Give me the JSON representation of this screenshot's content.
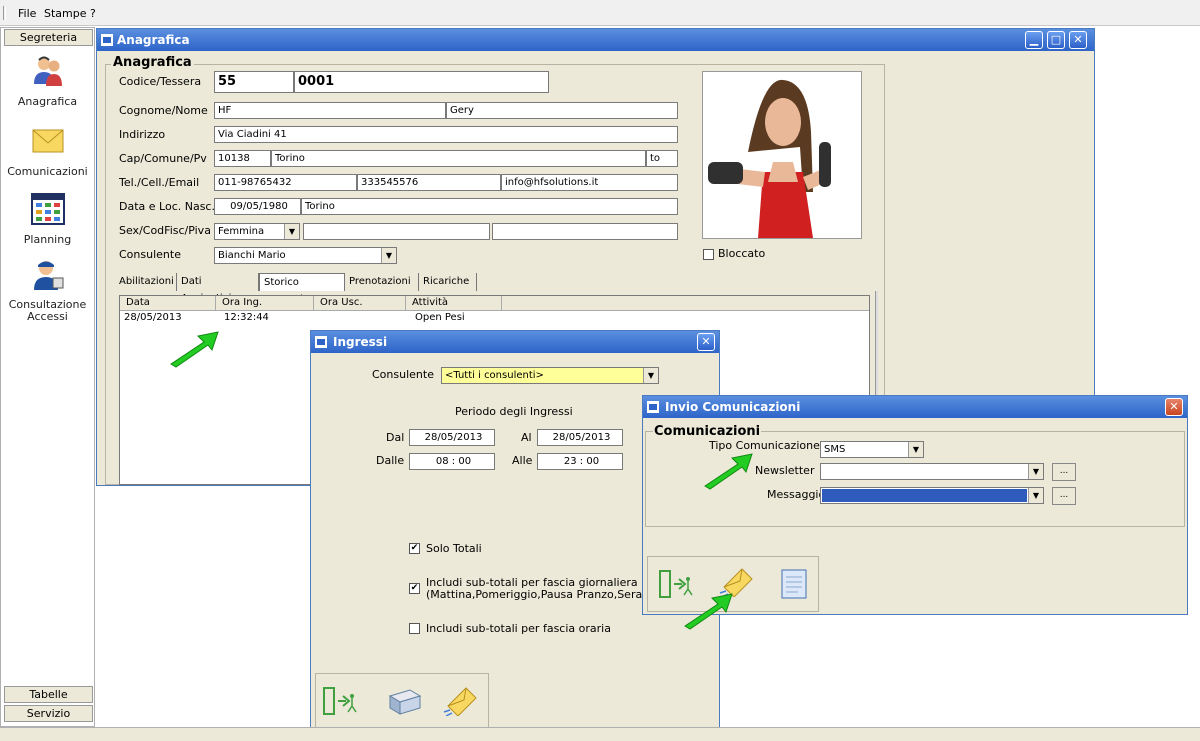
{
  "menu": [
    "File",
    "Stampe",
    "?"
  ],
  "sidebar": {
    "top_button": "Segreteria",
    "items": [
      {
        "label": "Anagrafica",
        "icon": "users-icon"
      },
      {
        "label": "Comunicazioni",
        "icon": "envelope-icon"
      },
      {
        "label": "Planning",
        "icon": "calendar-icon"
      },
      {
        "label": "Consultazione Accessi",
        "icon": "access-user-icon"
      }
    ],
    "bottom_buttons": [
      "Tabelle",
      "Servizio"
    ]
  },
  "main_window": {
    "title": "Anagrafica",
    "group_title": "Anagrafica",
    "labels": {
      "codice": "Codice/Tessera",
      "cognome": "Cognome/Nome",
      "indirizzo": "Indirizzo",
      "cap": "Cap/Comune/Pv",
      "tel": "Tel./Cell./Email",
      "nascita": "Data e Loc. Nasc.",
      "sex": "Sex/CodFisc/Piva",
      "consulente": "Consulente"
    },
    "values": {
      "codice1": "55",
      "codice2": "0001",
      "cognome": "HF",
      "nome": "Gery",
      "indirizzo": "Via Ciadini 41",
      "cap": "10138",
      "comune": "Torino",
      "pv": "to",
      "tel": "011-98765432",
      "cell": "333545576",
      "email": "info@hfsolutions.it",
      "data_nasc": "09/05/1980",
      "loc_nasc": "Torino",
      "sex": "Femmina",
      "codfisc": "",
      "piva": "",
      "consulente": "Bianchi Mario"
    },
    "bloccato_label": "Bloccato",
    "tabs": [
      "Abilitazioni",
      "Dati Aggiuntivi",
      "Storico Ingressi",
      "Prenotazioni",
      "Ricariche"
    ],
    "active_tab": "Storico Ingressi",
    "grid": {
      "columns": [
        "Data",
        "Ora Ing.",
        "Ora Usc.",
        "Attività"
      ],
      "rows": [
        {
          "data": "28/05/2013",
          "ora_ing": "12:32:44",
          "ora_usc": "",
          "attivita": "Open Pesi"
        }
      ]
    }
  },
  "ingressi_dialog": {
    "title": "Ingressi",
    "consulente_label": "Consulente",
    "consulente_value": "<Tutti i consulenti>",
    "periodo_label": "Periodo degli Ingressi",
    "dal_label": "Dal",
    "dal_value": "28/05/2013",
    "al_label": "Al",
    "al_value": "28/05/2013",
    "dalle_label": "Dalle",
    "dalle_value": "08 : 00",
    "alle_label": "Alle",
    "alle_value": "23 : 00",
    "checks": [
      {
        "label": "Solo Totali",
        "checked": true
      },
      {
        "label": "Includi sub-totali per fascia giornaliera",
        "label2": "(Mattina,Pomeriggio,Pausa Pranzo,Sera)",
        "checked": true
      },
      {
        "label": "Includi sub-totali per fascia oraria",
        "checked": false
      }
    ],
    "toolbar_icons": [
      "exit-icon",
      "printer-icon",
      "send-mail-icon"
    ]
  },
  "invio_dialog": {
    "title": "Invio Comunicazioni",
    "group_title": "Comunicazioni",
    "tipo_label": "Tipo Comunicazione",
    "tipo_value": "SMS",
    "newsletter_label": "Newsletter",
    "newsletter_value": "",
    "messaggio_label": "Messaggio",
    "messaggio_value": "",
    "browse_label": "...",
    "toolbar_icons": [
      "exit-icon",
      "send-mail-icon",
      "document-icon"
    ]
  },
  "colors": {
    "titlebar": "#2e64c8",
    "selection": "#2f5bbd",
    "highlight_yellow": "#ffff99",
    "arrow_green": "#22cc22"
  }
}
